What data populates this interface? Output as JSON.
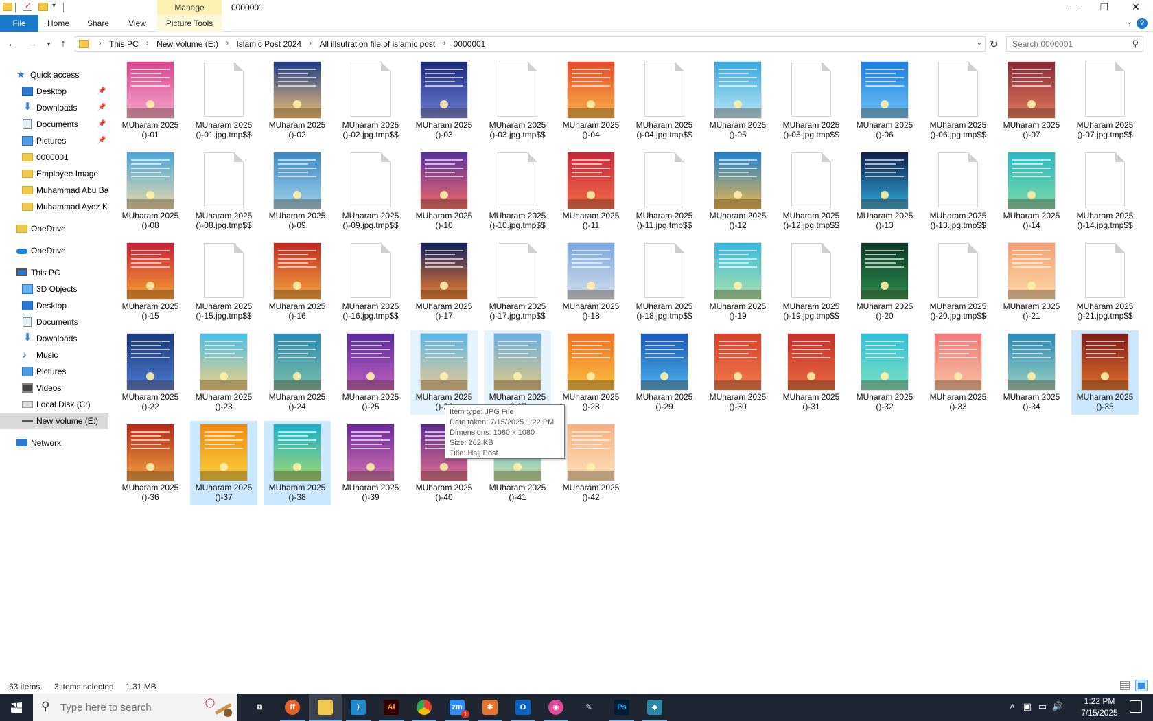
{
  "window": {
    "title": "0000001",
    "context_tab": "Manage",
    "minimize": "—",
    "restore": "❐",
    "close": "✕"
  },
  "ribbon": {
    "tabs": [
      "File",
      "Home",
      "Share",
      "View",
      "Picture Tools"
    ],
    "help": "?",
    "expand": "⌄"
  },
  "address": {
    "crumbs": [
      "This PC",
      "New Volume (E:)",
      "Islamic Post 2024",
      "All illsutration file of islamic post",
      "0000001"
    ],
    "search_placeholder": "Search 0000001"
  },
  "nav": {
    "quick_access": "Quick access",
    "pinned": [
      "Desktop",
      "Downloads",
      "Documents",
      "Pictures"
    ],
    "recent": [
      "0000001",
      "Employee Image",
      "Muhammad Abu Ba",
      "Muhammad Ayez K"
    ],
    "onedrive_1": "OneDrive",
    "onedrive_2": "OneDrive",
    "this_pc": "This PC",
    "pc_items": [
      "3D Objects",
      "Desktop",
      "Documents",
      "Downloads",
      "Music",
      "Pictures",
      "Videos",
      "Local Disk (C:)",
      "New Volume (E:)"
    ],
    "network": "Network"
  },
  "files": [
    {
      "l1": "MUharam 2025",
      "l2": "()-01",
      "kind": "image",
      "c1": "#d9478e",
      "c2": "#f3a7c9"
    },
    {
      "l1": "MUharam 2025",
      "l2": "()-01.jpg.tmp$$",
      "kind": "blank"
    },
    {
      "l1": "MUharam 2025",
      "l2": "()-02",
      "kind": "image",
      "c1": "#1d3f8a",
      "c2": "#f0c070"
    },
    {
      "l1": "MUharam 2025",
      "l2": "()-02.jpg.tmp$$",
      "kind": "blank"
    },
    {
      "l1": "MUharam 2025",
      "l2": "()-03",
      "kind": "image",
      "c1": "#1b2a7a",
      "c2": "#6e7fd6"
    },
    {
      "l1": "MUharam 2025",
      "l2": "()-03.jpg.tmp$$",
      "kind": "blank"
    },
    {
      "l1": "MUharam 2025",
      "l2": "()-04",
      "kind": "image",
      "c1": "#e74c2a",
      "c2": "#f7b24a"
    },
    {
      "l1": "MUharam 2025",
      "l2": "()-04.jpg.tmp$$",
      "kind": "blank"
    },
    {
      "l1": "MUharam 2025",
      "l2": "()-05",
      "kind": "image",
      "c1": "#3aa8e0",
      "c2": "#b8e6f4"
    },
    {
      "l1": "MUharam 2025",
      "l2": "()-05.jpg.tmp$$",
      "kind": "blank"
    },
    {
      "l1": "MUharam 2025",
      "l2": "()-06",
      "kind": "image",
      "c1": "#1c7fe0",
      "c2": "#6ec1f5"
    },
    {
      "l1": "MUharam 2025",
      "l2": "()-06.jpg.tmp$$",
      "kind": "blank"
    },
    {
      "l1": "MUharam 2025",
      "l2": "()-07",
      "kind": "image",
      "c1": "#8a2a3a",
      "c2": "#e0785a"
    },
    {
      "l1": "MUharam 2025",
      "l2": "()-07.jpg.tmp$$",
      "kind": "blank"
    },
    {
      "l1": "MUharam 2025",
      "l2": "()-08",
      "kind": "image",
      "c1": "#48a6d8",
      "c2": "#e6d9a8"
    },
    {
      "l1": "MUharam 2025",
      "l2": "()-08.jpg.tmp$$",
      "kind": "blank"
    },
    {
      "l1": "MUharam 2025",
      "l2": "()-09",
      "kind": "image",
      "c1": "#3b88c4",
      "c2": "#9fd0ea"
    },
    {
      "l1": "MUharam 2025",
      "l2": "()-09.jpg.tmp$$",
      "kind": "blank"
    },
    {
      "l1": "MUharam 2025",
      "l2": "()-10",
      "kind": "image",
      "c1": "#5a2f9a",
      "c2": "#f06a6a"
    },
    {
      "l1": "MUharam 2025",
      "l2": "()-10.jpg.tmp$$",
      "kind": "blank"
    },
    {
      "l1": "MUharam 2025",
      "l2": "()-11",
      "kind": "image",
      "c1": "#c42a3a",
      "c2": "#f36a4a"
    },
    {
      "l1": "MUharam 2025",
      "l2": "()-11.jpg.tmp$$",
      "kind": "blank"
    },
    {
      "l1": "MUharam 2025",
      "l2": "()-12",
      "kind": "image",
      "c1": "#1f7fcf",
      "c2": "#e8b84a"
    },
    {
      "l1": "MUharam 2025",
      "l2": "()-12.jpg.tmp$$",
      "kind": "blank"
    },
    {
      "l1": "MUharam 2025",
      "l2": "()-13",
      "kind": "image",
      "c1": "#0f1f4a",
      "c2": "#2fa8d8"
    },
    {
      "l1": "MUharam 2025",
      "l2": "()-13.jpg.tmp$$",
      "kind": "blank"
    },
    {
      "l1": "MUharam 2025",
      "l2": "()-14",
      "kind": "image",
      "c1": "#2ab8c0",
      "c2": "#7ad8a8"
    },
    {
      "l1": "MUharam 2025",
      "l2": "()-14.jpg.tmp$$",
      "kind": "blank"
    },
    {
      "l1": "MUharam 2025",
      "l2": "()-15",
      "kind": "image",
      "c1": "#c8203a",
      "c2": "#f6a030"
    },
    {
      "l1": "MUharam 2025",
      "l2": "()-15.jpg.tmp$$",
      "kind": "blank"
    },
    {
      "l1": "MUharam 2025",
      "l2": "()-16",
      "kind": "image",
      "c1": "#c02a20",
      "c2": "#f5a540"
    },
    {
      "l1": "MUharam 2025",
      "l2": "()-16.jpg.tmp$$",
      "kind": "blank"
    },
    {
      "l1": "MUharam 2025",
      "l2": "()-17",
      "kind": "image",
      "c1": "#101f5a",
      "c2": "#f08030"
    },
    {
      "l1": "MUharam 2025",
      "l2": "()-17.jpg.tmp$$",
      "kind": "blank"
    },
    {
      "l1": "MUharam 2025",
      "l2": "()-18",
      "kind": "image",
      "c1": "#7aa8e0",
      "c2": "#d4dcea"
    },
    {
      "l1": "MUharam 2025",
      "l2": "()-18.jpg.tmp$$",
      "kind": "blank"
    },
    {
      "l1": "MUharam 2025",
      "l2": "()-19",
      "kind": "image",
      "c1": "#3ab8e0",
      "c2": "#a8e0a8"
    },
    {
      "l1": "MUharam 2025",
      "l2": "()-19.jpg.tmp$$",
      "kind": "blank"
    },
    {
      "l1": "MUharam 2025",
      "l2": "()-20",
      "kind": "image",
      "c1": "#0f3a2a",
      "c2": "#2a8a4a"
    },
    {
      "l1": "MUharam 2025",
      "l2": "()-20.jpg.tmp$$",
      "kind": "blank"
    },
    {
      "l1": "MUharam 2025",
      "l2": "()-21",
      "kind": "image",
      "c1": "#f5a070",
      "c2": "#fbd8a8"
    },
    {
      "l1": "MUharam 2025",
      "l2": "()-21.jpg.tmp$$",
      "kind": "blank"
    },
    {
      "l1": "MUharam 2025",
      "l2": "()-22",
      "kind": "image",
      "c1": "#1a3a7a",
      "c2": "#4a7ad0"
    },
    {
      "l1": "MUharam 2025",
      "l2": "()-23",
      "kind": "image",
      "c1": "#48c0e8",
      "c2": "#f0d080"
    },
    {
      "l1": "MUharam 2025",
      "l2": "()-24",
      "kind": "image",
      "c1": "#2a8ab0",
      "c2": "#7ac0a8"
    },
    {
      "l1": "MUharam 2025",
      "l2": "()-25",
      "kind": "image",
      "c1": "#5a2a9a",
      "c2": "#c060c0"
    },
    {
      "l1": "MUharam 2025",
      "l2": "()-26",
      "kind": "image",
      "c1": "#5ab8e8",
      "c2": "#e8c890"
    },
    {
      "l1": "MUharam 2025",
      "l2": "()-27",
      "kind": "image",
      "c1": "#6ab0e0",
      "c2": "#e0c880"
    },
    {
      "l1": "MUharam 2025",
      "l2": "()-28",
      "kind": "image",
      "c1": "#f07020",
      "c2": "#f8c040"
    },
    {
      "l1": "MUharam 2025",
      "l2": "()-29",
      "kind": "image",
      "c1": "#1a5ab8",
      "c2": "#4ab0e8"
    },
    {
      "l1": "MUharam 2025",
      "l2": "()-30",
      "kind": "image",
      "c1": "#d8402a",
      "c2": "#f07a4a"
    },
    {
      "l1": "MUharam 2025",
      "l2": "()-31",
      "kind": "image",
      "c1": "#c8302a",
      "c2": "#e86a40"
    },
    {
      "l1": "MUharam 2025",
      "l2": "()-32",
      "kind": "image",
      "c1": "#30c0d8",
      "c2": "#7ae0c0"
    },
    {
      "l1": "MUharam 2025",
      "l2": "()-33",
      "kind": "image",
      "c1": "#f07a7a",
      "c2": "#f8c0a0"
    },
    {
      "l1": "MUharam 2025",
      "l2": "()-34",
      "kind": "image",
      "c1": "#2a8ab8",
      "c2": "#9ad0c0"
    },
    {
      "l1": "MUharam 2025",
      "l2": "()-35",
      "kind": "image",
      "c1": "#801a1a",
      "c2": "#e0702a"
    },
    {
      "l1": "MUharam 2025",
      "l2": "()-36",
      "kind": "image",
      "c1": "#b02a1a",
      "c2": "#f0a040"
    },
    {
      "l1": "MUharam 2025",
      "l2": "()-37",
      "kind": "image",
      "c1": "#f08a10",
      "c2": "#f8d040"
    },
    {
      "l1": "MUharam 2025",
      "l2": "()-38",
      "kind": "image",
      "c1": "#1ab0c8",
      "c2": "#a0d870"
    },
    {
      "l1": "MUharam 2025",
      "l2": "()-39",
      "kind": "image",
      "c1": "#6a2a9a",
      "c2": "#d070b0"
    },
    {
      "l1": "MUharam 2025",
      "l2": "()-40",
      "kind": "image",
      "c1": "#5a2a8a",
      "c2": "#e07090"
    },
    {
      "l1": "MUharam 2025",
      "l2": "()-41",
      "kind": "image",
      "c1": "#5ab0e8",
      "c2": "#c0e0a0"
    },
    {
      "l1": "MUharam 2025",
      "l2": "()-42",
      "kind": "image",
      "c1": "#f8b080",
      "c2": "#fde0b8"
    }
  ],
  "selected_indices": [
    55,
    57,
    58
  ],
  "hover_indices": [
    46,
    47
  ],
  "tooltip": {
    "type": "Item type: JPG File",
    "date": "Date taken: 7/15/2025 1:22 PM",
    "dims": "Dimensions: 1080 x 1080",
    "size": "Size: 262 KB",
    "title": "Title: Hajj Post"
  },
  "status": {
    "count": "63 items",
    "selected": "3 items selected",
    "size": "1.31 MB"
  },
  "taskbar": {
    "search_placeholder": "Type here to search",
    "apps": [
      {
        "name": "task-view",
        "glyph": "⧉",
        "color": "#1f2631"
      },
      {
        "name": "firefox",
        "glyph": "ff",
        "color": "#e8632a"
      },
      {
        "name": "file-explorer",
        "glyph": "",
        "color": "#f2c94c"
      },
      {
        "name": "vscode",
        "glyph": "⟩",
        "color": "#1f8ad2"
      },
      {
        "name": "illustrator",
        "glyph": "Ai",
        "color": "#330000"
      },
      {
        "name": "chrome",
        "glyph": "",
        "color": "#34a853"
      },
      {
        "name": "zoom",
        "glyph": "zm",
        "color": "#2d8cff"
      },
      {
        "name": "hotspot",
        "glyph": "✱",
        "color": "#e8732a"
      },
      {
        "name": "outlook",
        "glyph": "O",
        "color": "#0a64c8"
      },
      {
        "name": "capture",
        "glyph": "◉",
        "color": "#e0489a"
      },
      {
        "name": "pen-tool",
        "glyph": "✎",
        "color": "#1f2631"
      },
      {
        "name": "photoshop",
        "glyph": "Ps",
        "color": "#001e36"
      },
      {
        "name": "app-diamond",
        "glyph": "◆",
        "color": "#2a8aa8"
      }
    ],
    "zoom_badge": "1",
    "time": "1:22 PM",
    "date": "7/15/2025"
  }
}
